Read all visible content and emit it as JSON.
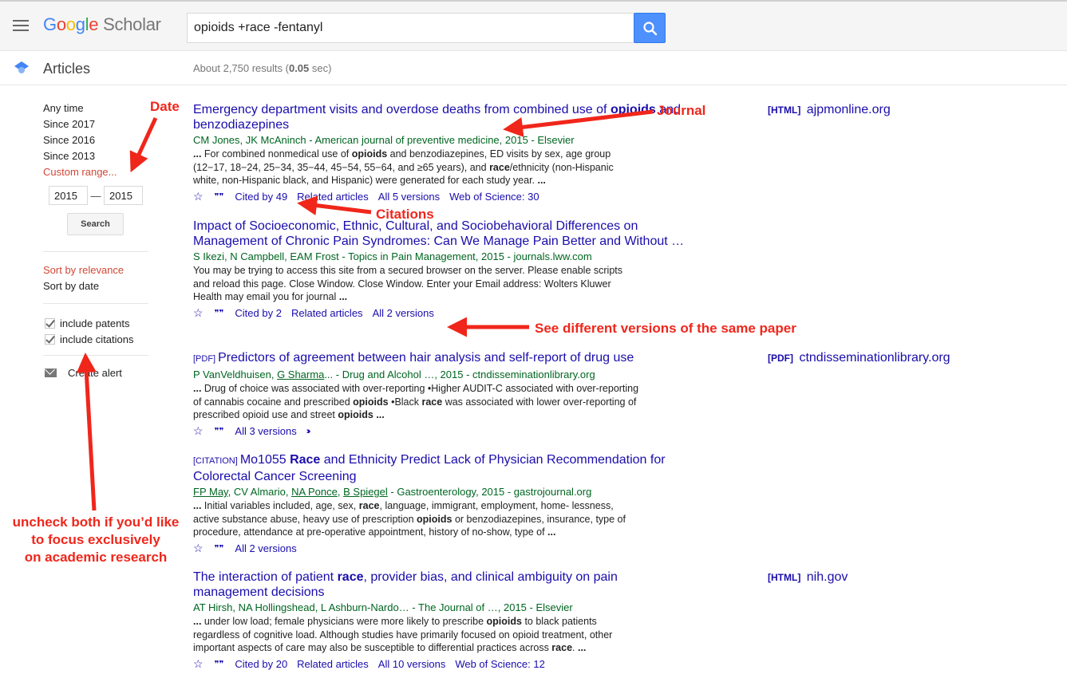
{
  "header": {
    "logo_letters": [
      "G",
      "o",
      "o",
      "g",
      "l",
      "e"
    ],
    "logo_suffix": "Scholar",
    "search_query": "opioids +race -fentanyl",
    "search_button_icon": "search-icon"
  },
  "subheader": {
    "section": "Articles",
    "stats_prefix": "About 2,750 results (",
    "stats_time": "0.05",
    "stats_suffix": " sec)"
  },
  "sidebar": {
    "time_filters": [
      "Any time",
      "Since 2017",
      "Since 2016",
      "Since 2013",
      "Custom range..."
    ],
    "active_time_filter": "Custom range...",
    "range_from": "2015",
    "range_to": "2015",
    "range_separator": "—",
    "search_button": "Search",
    "sort_options": [
      "Sort by relevance",
      "Sort by date"
    ],
    "active_sort": "Sort by relevance",
    "checkboxes": [
      {
        "label": "include patents",
        "checked": true
      },
      {
        "label": "include citations",
        "checked": true
      }
    ],
    "create_alert": "Create alert"
  },
  "results": [
    {
      "tag": "",
      "title_html": "Emergency department visits and overdose deaths from combined use of <b>opioids</b> and benzodiazepines",
      "meta": "CM Jones, JK McAninch - American journal of preventive medicine, 2015 - Elsevier",
      "snippet_html": "<b>...</b> For combined nonmedical use of <b>opioids</b> and benzodiazepines, ED visits by sex, age group (12−17, 18−24, 25−34, 35−44, 45−54, 55−64, and ≥65 years), and <b>race</b>/ethnicity (non-Hispanic white, non-Hispanic black, and Hispanic) were generated for each study year. <b>...</b>",
      "links": [
        "Cited by 49",
        "Related articles",
        "All 5 versions",
        "Web of Science: 30"
      ],
      "side_tag": "[HTML]",
      "side_source": "ajpmonline.org"
    },
    {
      "tag": "",
      "title_html": "Impact of Socioeconomic, Ethnic, Cultural, and Sociobehavioral Differences on Management of Chronic Pain Syndromes: Can We Manage Pain Better and Without …",
      "meta": "S Ikezi, N Campbell, EAM Frost - Topics in Pain Management, 2015 - journals.lww.com",
      "snippet_html": "You may be trying to access this site from a secured browser on the server. Please enable scripts and reload this page. Close Window. Close Window. Enter your Email address: Wolters Kluwer Health may email you for journal <b>...</b>",
      "links": [
        "Cited by 2",
        "Related articles",
        "All 2 versions"
      ],
      "side_tag": "",
      "side_source": ""
    },
    {
      "tag": "[PDF]",
      "title_html": "Predictors of agreement between hair analysis and self-report of drug use",
      "meta_html": "P VanVeldhuisen, <u>G Sharma</u>... - Drug and Alcohol …, 2015 - ctndisseminationlibrary.org",
      "snippet_html": "<b>...</b> Drug of choice was associated with over-reporting •Higher AUDIT-C associated with over-reporting of cannabis cocaine and prescribed <b>opioids</b> •Black <b>race</b> was associated with lower over-reporting of prescribed opioid use and street <b>opioids</b> <b>...</b>",
      "links": [
        "All 3 versions"
      ],
      "has_more": true,
      "side_tag": "[PDF]",
      "side_source": "ctndisseminationlibrary.org"
    },
    {
      "tag": "[CITATION]",
      "title_html": "Mo1055 <b>Race</b> and Ethnicity Predict Lack of Physician Recommendation for Colorectal Cancer Screening",
      "meta_html": "<u>FP May</u>, CV Almario, <u>NA Ponce</u>, <u>B Spiegel</u> - Gastroenterology, 2015 - gastrojournal.org",
      "snippet_html": "<b>...</b> Initial variables included, age, sex, <b>race</b>, language, immigrant, employment, home- lessness, active substance abuse, heavy use of prescription <b>opioids</b> or benzodiazepines, insurance, type of procedure, attendance at pre-operative appointment, history of no-show, type of <b>...</b>",
      "links": [
        "All 2 versions"
      ],
      "side_tag": "",
      "side_source": ""
    },
    {
      "tag": "",
      "title_html": "The interaction of patient <b>race</b>, provider bias, and clinical ambiguity on pain management decisions",
      "meta": "AT Hirsh, NA Hollingshead, L Ashburn-Nardo… - The Journal of …, 2015 - Elsevier",
      "snippet_html": "<b>...</b> under low load; female physicians were more likely to prescribe <b>opioids</b> to black patients regardless of cognitive load. Although studies have primarily focused on opioid treatment, other important aspects of care may also be susceptible to differential practices across <b>race</b>. <b>...</b>",
      "links": [
        "Cited by 20",
        "Related articles",
        "All 10 versions",
        "Web of Science: 12"
      ],
      "side_tag": "[HTML]",
      "side_source": "nih.gov"
    }
  ],
  "annotations": {
    "date": "Date",
    "journal": "Journal",
    "citations": "Citations",
    "versions": "See different versions of the same paper",
    "uncheck_lines": [
      "uncheck both if you’d like",
      "to focus exclusively",
      "on academic research"
    ]
  },
  "colors": {
    "link": "#1a0dab",
    "meta_green": "#006621",
    "active_red": "#d14836",
    "annotation_red": "#f0261b",
    "search_blue": "#4d90fe"
  }
}
